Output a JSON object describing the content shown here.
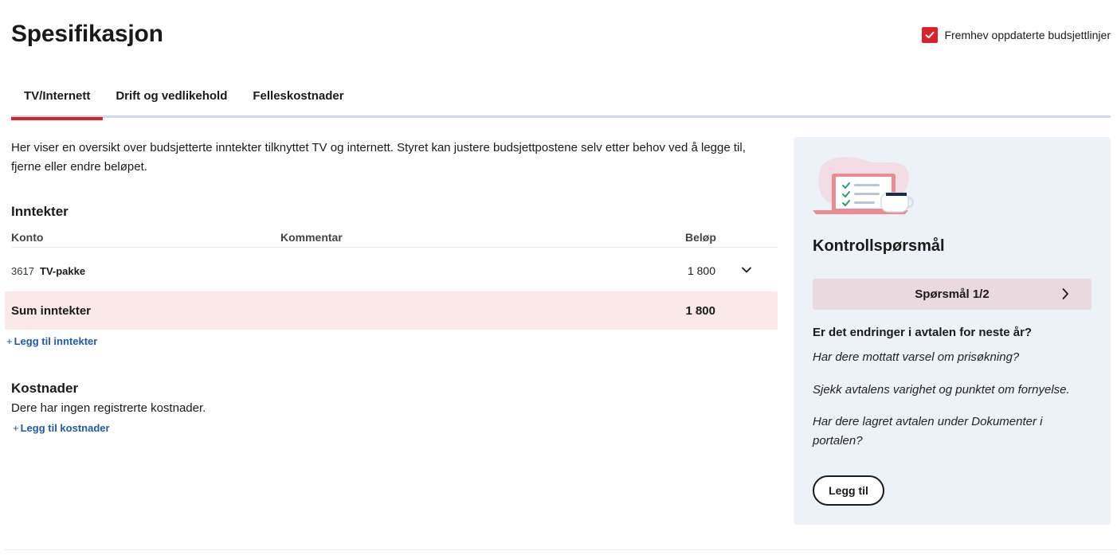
{
  "page": {
    "title": "Spesifikasjon"
  },
  "highlight": {
    "label": "Fremhev oppdaterte budsjettlinjer",
    "checked": true
  },
  "tabs": [
    {
      "label": "TV/Internett",
      "active": true
    },
    {
      "label": "Drift og vedlikehold",
      "active": false
    },
    {
      "label": "Felleskostnader",
      "active": false
    }
  ],
  "intro": "Her viser en oversikt over budsjetterte inntekter tilknyttet TV og internett. Styret kan justere budsjettpostene selv etter behov ved å legge til, fjerne eller endre beløpet.",
  "income": {
    "heading": "Inntekter",
    "columns": {
      "account": "Konto",
      "comment": "Kommentar",
      "amount": "Beløp"
    },
    "rows": [
      {
        "number": "3617",
        "name": "TV-pakke",
        "comment": "",
        "amount": "1 800"
      }
    ],
    "sum": {
      "label": "Sum inntekter",
      "amount": "1 800"
    },
    "add_link": "Legg til inntekter"
  },
  "costs": {
    "heading": "Kostnader",
    "empty": "Dere har ingen registrerte kostnader.",
    "add_link": "Legg til kostnader"
  },
  "panel": {
    "title": "Kontrollspørsmål",
    "nav_label": "Spørsmål 1/2",
    "question_heading": "Er det endringer i avtalen for neste år?",
    "questions": [
      "Har dere mottatt varsel om prisøkning?",
      "Sjekk avtalens varighet og punktet om fornyelse.",
      "Har dere lagret avtalen under Dokumenter i portalen?"
    ],
    "button_label": "Legg til"
  },
  "colors": {
    "accent": "#d8232a",
    "link": "#1d5aa8",
    "sum_bg": "#fbe8e8",
    "panel_bg": "#edf2f9",
    "nav_bg": "#ead9df",
    "tab_border": "#d3d9e6"
  },
  "icons": {
    "checkbox": "checkmark-icon",
    "row_expand": "chevron-down-icon",
    "next_question": "chevron-right-icon",
    "illustration": "laptop-checklist-illustration"
  }
}
